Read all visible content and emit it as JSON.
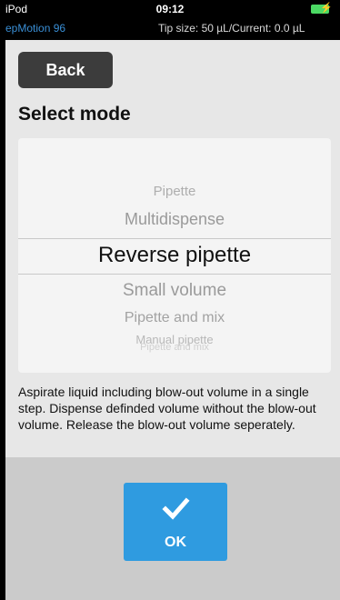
{
  "status_bar": {
    "carrier": "iPod",
    "time": "09:12"
  },
  "app_bar": {
    "device_name": "epMotion 96",
    "tip_info": "Tip size:   50 µL/Current:     0.0 µL"
  },
  "header": {
    "back_label": "Back",
    "title": "Select mode"
  },
  "mode_picker": {
    "items": [
      "Pipette",
      "Multidispense",
      "Reverse pipette",
      "Small volume",
      "Pipette and mix",
      "Manual pipette"
    ],
    "selected_index": 2,
    "faded_below": "Pipette and mix"
  },
  "description": "Aspirate liquid including blow-out volume in a single step. Dispense definded volume without the blow-out volume. Release the blow-out volume seperately.",
  "ok_button": {
    "label": "OK",
    "icon": "checkmark-icon"
  },
  "colors": {
    "accent_blue": "#2f9be0",
    "device_name_blue": "#3a8fd6",
    "battery_green": "#4cd964",
    "back_button_bg": "#3c3c3c"
  }
}
